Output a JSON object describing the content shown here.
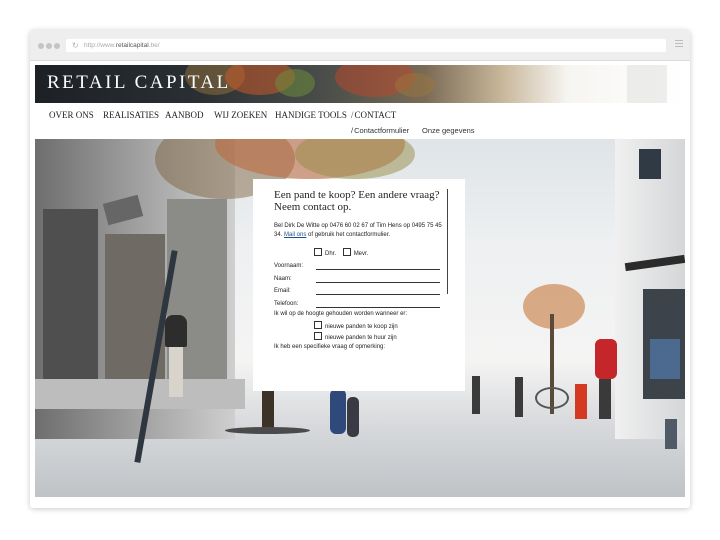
{
  "browser": {
    "url_prefix": "http://www.",
    "url_domain": "retailcapital",
    "url_suffix": ".be/"
  },
  "site": {
    "logo": "RETAIL CAPITAL",
    "nav": [
      {
        "label": "OVER ONS"
      },
      {
        "label": "REALISATIES"
      },
      {
        "label": "AANBOD"
      },
      {
        "label": "WIJ ZOEKEN"
      },
      {
        "label": "HANDIGE TOOLS"
      },
      {
        "label": "CONTACT",
        "active": true
      }
    ],
    "subnav": [
      {
        "label": "Contactformulier",
        "active": true
      },
      {
        "label": "Onze gegevens"
      }
    ]
  },
  "form": {
    "heading": "Een pand te koop? Een andere vraag? Neem contact op.",
    "intro_before": "Bel Dirk De Witte op 0476 60 02 67 of Tim Hens op 0495 75 45 34.",
    "intro_link": "Mail ons",
    "intro_after": "of gebruik het contactformulier.",
    "salutation_options": [
      "Dhr.",
      "Mevr."
    ],
    "fields": [
      {
        "label": "Voornaam:",
        "value": ""
      },
      {
        "label": "Naam:",
        "value": ""
      },
      {
        "label": "Email:",
        "value": ""
      },
      {
        "label": "Telefoon:",
        "value": ""
      }
    ],
    "interest_label": "Ik wil op de hoogte gehouden worden wanneer er:",
    "interest_options": [
      "nieuwe panden te koop zijn",
      "nieuwe panden te huur zijn"
    ],
    "question_label": "Ik heb een specifieke vraag of opmerking:"
  },
  "colors": {
    "link": "#1f4f8a",
    "text": "#222222"
  }
}
